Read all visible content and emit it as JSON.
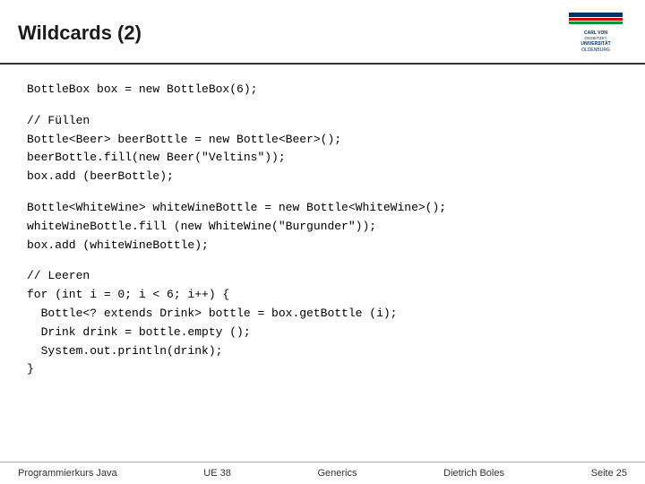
{
  "header": {
    "title": "Wildcards (2)"
  },
  "footer": {
    "course": "Programmierkurs Java",
    "ue": "UE 38",
    "topic": "Generics",
    "author": "Dietrich Boles",
    "page": "Seite 25"
  },
  "code": {
    "section1": "BottleBox box = new BottleBox(6);",
    "section2": "// Füllen\nBottle<Beer> beerBottle = new Bottle<Beer>();\nbeerBottle.fill(new Beer(\"Veltins\"));\nbox.add (beerBottle);",
    "section3": "Bottle<WhiteWine> whiteWineBottle = new Bottle<WhiteWine>();\nwhiteWineBottle.fill (new WhiteWine(\"Burgunder\"));\nbox.add (whiteWineBottle);",
    "section4": "// Leeren\nfor (int i = 0; i < 6; i++) {\n  Bottle<? extends Drink> bottle = box.getBottle (i);\n  Drink drink = bottle.empty ();\n  System.out.println(drink);\n}"
  }
}
